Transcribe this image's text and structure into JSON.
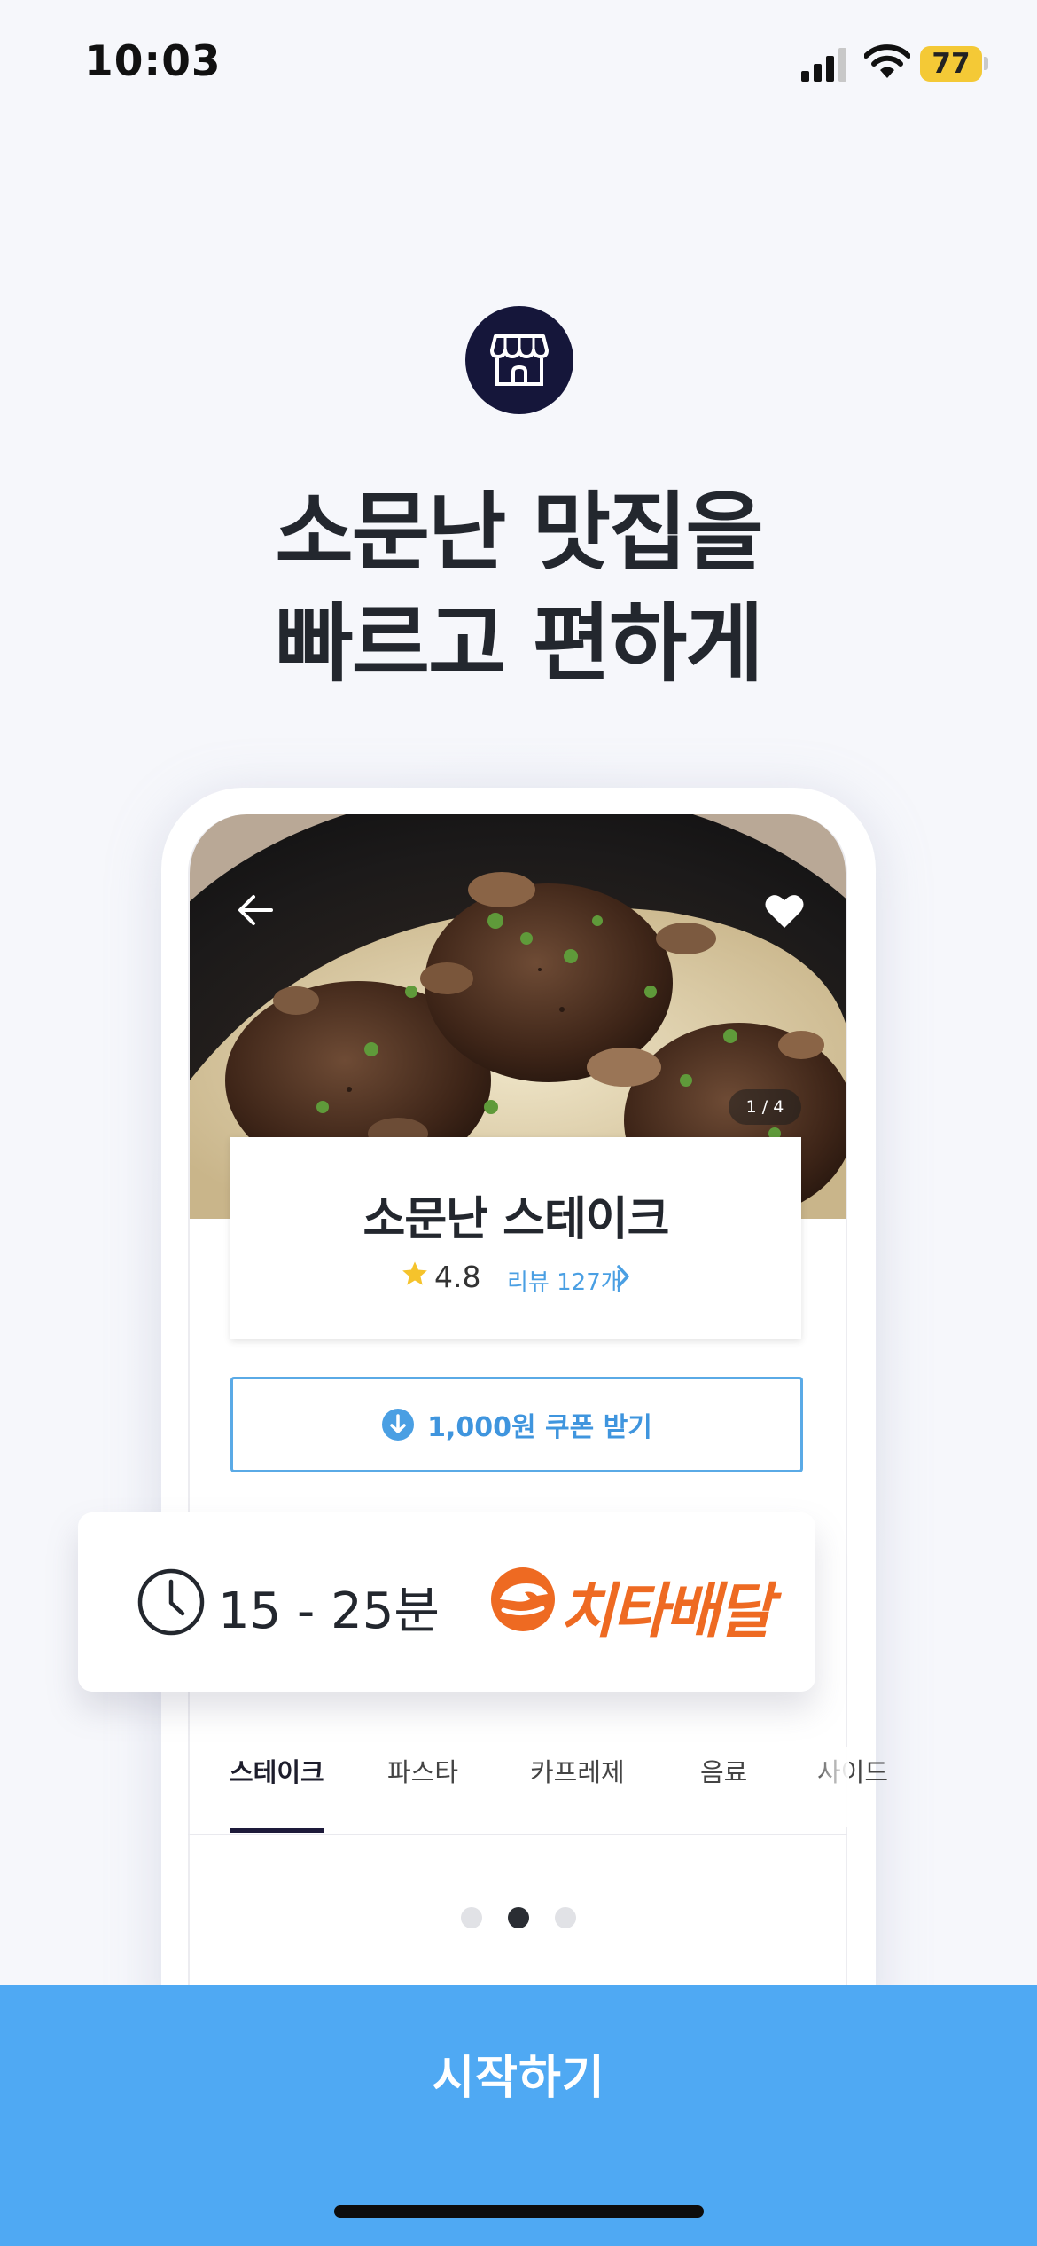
{
  "status_bar": {
    "time": "10:03",
    "battery": "77"
  },
  "hero": {
    "headline_line1": "소문난 맛집을",
    "headline_line2": "빠르고 편하게"
  },
  "store": {
    "name": "소문난 스테이크",
    "rating": "4.8",
    "review_link": "리뷰 127개",
    "photo_counter": "1 / 4"
  },
  "coupon": {
    "label": "1,000원 쿠폰 받기"
  },
  "delivery": {
    "time": "15 - 25분",
    "brand": "치타배달"
  },
  "tabs": [
    {
      "label": "스테이크",
      "active": true
    },
    {
      "label": "파스타",
      "active": false
    },
    {
      "label": "카프레제",
      "active": false
    },
    {
      "label": "음료",
      "active": false
    },
    {
      "label": "사이드",
      "active": false
    }
  ],
  "pagination": {
    "count": 3,
    "active_index": 1
  },
  "cta": {
    "label": "시작하기"
  },
  "colors": {
    "accent": "#4fa9f3",
    "link": "#4a9fe3",
    "brand_orange": "#ee6a22",
    "icon_badge": "#15163a"
  }
}
